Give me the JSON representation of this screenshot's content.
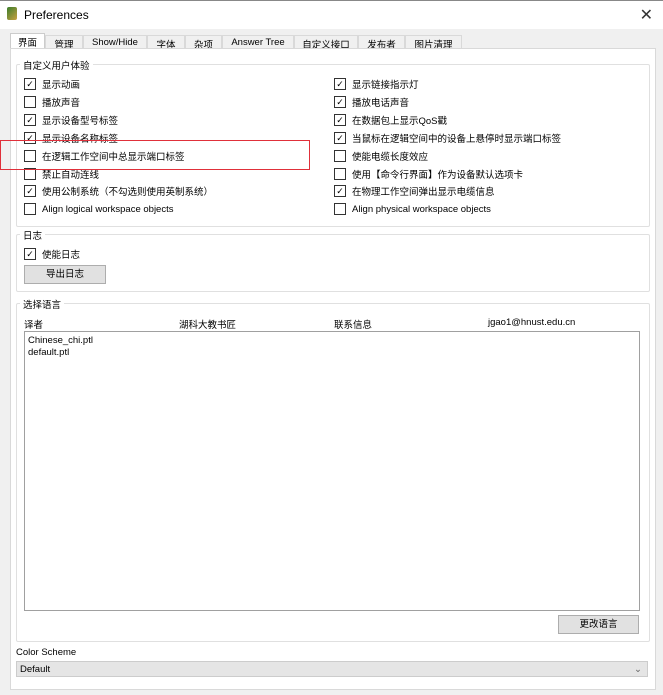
{
  "window": {
    "title": "Preferences",
    "close": "✕"
  },
  "tabs": [
    "界面",
    "管理",
    "Show/Hide",
    "字体",
    "杂项",
    "Answer Tree",
    "自定义接口",
    "发布者",
    "图片清理"
  ],
  "ux_group": {
    "label": "自定义用户体验",
    "left": [
      {
        "label": "显示动画",
        "checked": true
      },
      {
        "label": "播放声音",
        "checked": false
      },
      {
        "label": "显示设备型号标签",
        "checked": true
      },
      {
        "label": "显示设备名称标签",
        "checked": true
      },
      {
        "label": "在逻辑工作空间中总显示端口标签",
        "checked": false
      },
      {
        "label": "禁止自动连线",
        "checked": false
      },
      {
        "label": "使用公制系统（不勾选则使用英制系统）",
        "checked": true
      },
      {
        "label": "Align logical workspace objects",
        "checked": false
      }
    ],
    "right": [
      {
        "label": "显示链接指示灯",
        "checked": true
      },
      {
        "label": "播放电话声音",
        "checked": true
      },
      {
        "label": "在数据包上显示QoS戳",
        "checked": true
      },
      {
        "label": "当鼠标在逻辑空间中的设备上悬停时显示端口标签",
        "checked": true
      },
      {
        "label": "使能电缆长度效应",
        "checked": false
      },
      {
        "label": "使用【命令行界面】作为设备默认选项卡",
        "checked": false
      },
      {
        "label": "在物理工作空间弹出显示电缆信息",
        "checked": true
      },
      {
        "label": "Align physical workspace objects",
        "checked": false
      }
    ]
  },
  "log_group": {
    "label": "日志",
    "enable": {
      "label": "使能日志",
      "checked": true
    },
    "export_button": "导出日志"
  },
  "lang_group": {
    "label": "选择语言",
    "translator_label": "译者",
    "translator": "湖科大教书匠",
    "contact_label": "联系信息",
    "contact": "jgao1@hnust.edu.cn",
    "files": [
      "Chinese_chi.ptl",
      "default.ptl"
    ],
    "change_button": "更改语言"
  },
  "color_scheme": {
    "label": "Color Scheme",
    "value": "Default"
  },
  "highlight_color": "#e0303a"
}
